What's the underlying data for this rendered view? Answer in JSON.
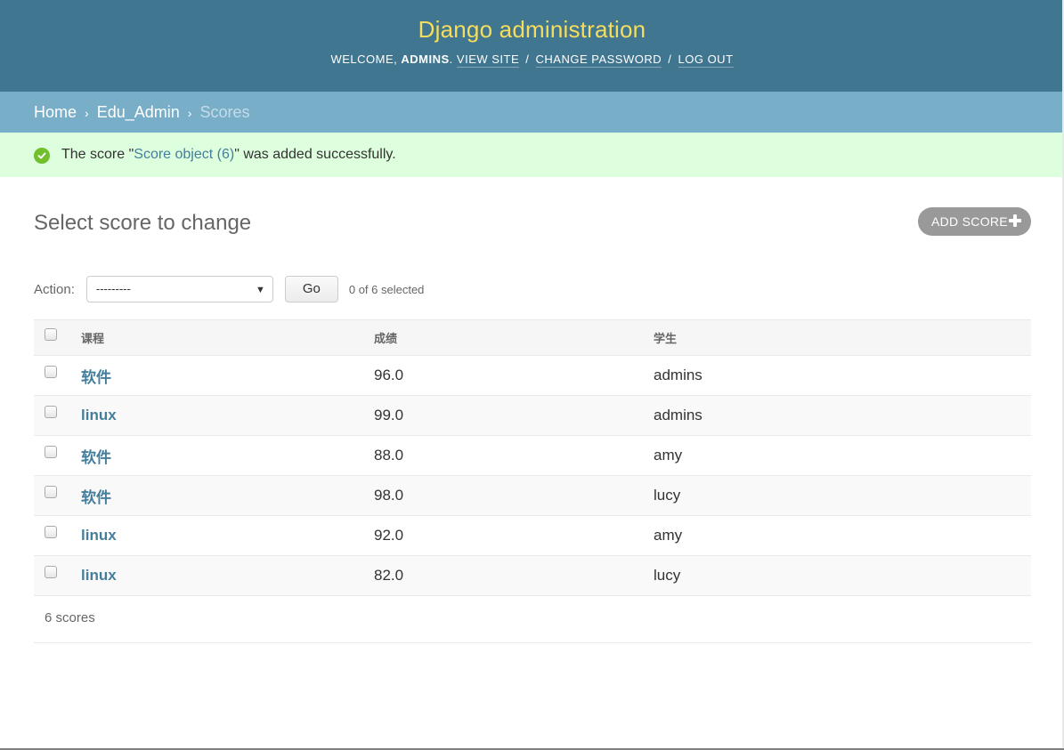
{
  "header": {
    "site_title": "Django administration",
    "welcome_text": "Welcome,",
    "username": "admins",
    "view_site": "View site",
    "change_password": "Change password",
    "log_out": "Log out",
    "separator": "/"
  },
  "breadcrumbs": {
    "home": "Home",
    "app": "Edu_Admin",
    "current": "Scores",
    "separator": "›"
  },
  "message": {
    "prefix": "The score \"",
    "object_link": "Score object (6)",
    "suffix": "\" was added successfully.",
    "icon": "check-circle-icon"
  },
  "page": {
    "title": "Select score to change",
    "add_button": "Add score"
  },
  "actions": {
    "label": "Action:",
    "selected_option": "---------",
    "go_label": "Go",
    "counter": "0 of 6 selected"
  },
  "table": {
    "columns": [
      "课程",
      "成绩",
      "学生"
    ],
    "rows": [
      {
        "course": "软件",
        "score": "96.0",
        "student": "admins"
      },
      {
        "course": "linux",
        "score": "99.0",
        "student": "admins"
      },
      {
        "course": "软件",
        "score": "88.0",
        "student": "amy"
      },
      {
        "course": "软件",
        "score": "98.0",
        "student": "lucy"
      },
      {
        "course": "linux",
        "score": "92.0",
        "student": "amy"
      },
      {
        "course": "linux",
        "score": "82.0",
        "student": "lucy"
      }
    ]
  },
  "paginator": {
    "count_text": "6 scores"
  },
  "colors": {
    "header_bg": "#417690",
    "title": "#f5dd5d",
    "breadcrumbs_bg": "#79aec8",
    "message_bg": "#ddffdd",
    "link": "#447e9b",
    "success_icon": "#70bf2b"
  }
}
